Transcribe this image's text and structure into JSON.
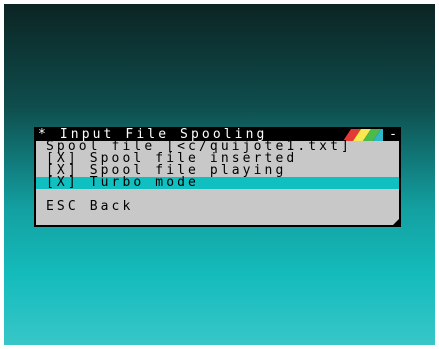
{
  "window": {
    "title": "* Input File Spooling",
    "close_glyph": "-",
    "stripe_colors": [
      "#e53935",
      "#f9e94e",
      "#4cbb4a",
      "#2fb7c8"
    ]
  },
  "menu": {
    "items": [
      {
        "label": "Spool file [<c/quijote1.txt]",
        "selected": false
      },
      {
        "label": "[X] Spool file inserted",
        "selected": false
      },
      {
        "label": "[X] Spool file playing",
        "selected": false
      },
      {
        "label": "[X] Turbo mode",
        "selected": true
      }
    ],
    "back_label": "ESC Back"
  },
  "colors": {
    "window_bg": "#c8c8c8",
    "selection": "#10bfbf",
    "titlebar": "#000000"
  }
}
